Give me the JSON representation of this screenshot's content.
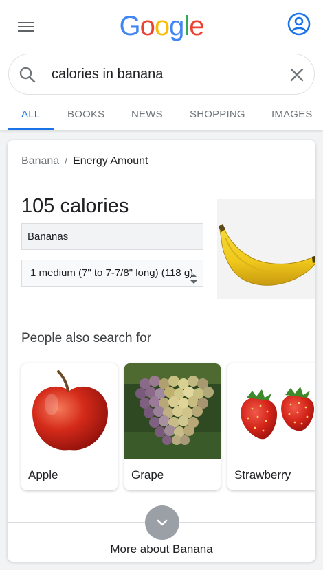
{
  "header": {
    "logo": [
      "G",
      "o",
      "o",
      "g",
      "l",
      "e"
    ],
    "logo_colors": [
      "#4285f4",
      "#ea4335",
      "#fbbc05",
      "#4285f4",
      "#34a853",
      "#ea4335"
    ],
    "menu_icon": "hamburger-menu-icon",
    "account_icon": "account-circle-icon",
    "account_color": "#1a73e8"
  },
  "search": {
    "value": "calories in banana",
    "search_icon": "search-icon",
    "clear_icon": "close-icon"
  },
  "tabs": {
    "items": [
      {
        "label": "ALL",
        "active": true
      },
      {
        "label": "BOOKS",
        "active": false
      },
      {
        "label": "NEWS",
        "active": false
      },
      {
        "label": "SHOPPING",
        "active": false
      },
      {
        "label": "IMAGES",
        "active": false
      }
    ],
    "accent_color": "#1a73e8"
  },
  "card": {
    "breadcrumb": {
      "parent": "Banana",
      "separator": "/",
      "current": "Energy Amount"
    },
    "calories": "105 calories",
    "food_select": "Bananas",
    "portion_select": "1 medium (7\" to 7-7/8\" long) (118 g)",
    "image": "banana-image",
    "people_also_search": {
      "title": "People also search for",
      "items": [
        {
          "label": "Apple",
          "image": "apple-image"
        },
        {
          "label": "Grape",
          "image": "grape-image"
        },
        {
          "label": "Strawberry",
          "image": "strawberry-image"
        }
      ]
    },
    "expand_icon": "chevron-down-icon",
    "more_link": "More about Banana"
  }
}
